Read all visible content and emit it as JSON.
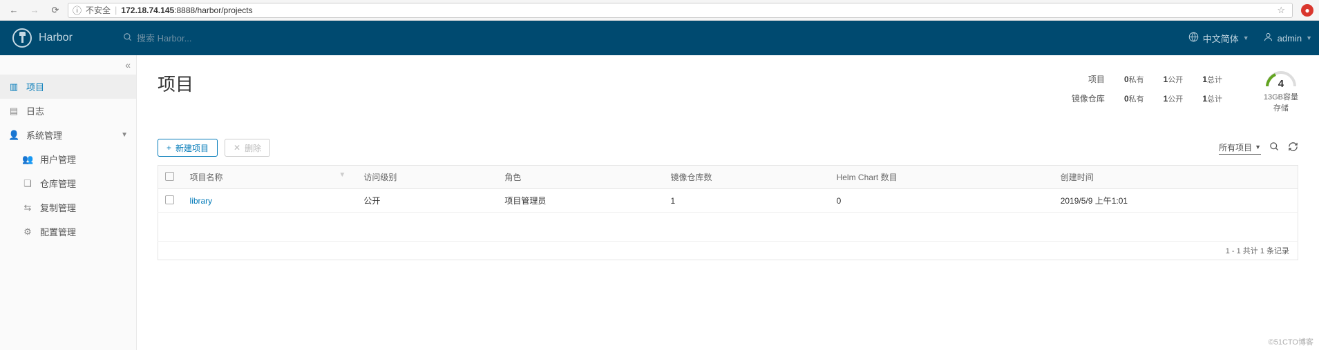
{
  "browser": {
    "insecure_label": "不安全",
    "url_host": "172.18.74.145",
    "url_rest": ":8888/harbor/projects"
  },
  "header": {
    "app_name": "Harbor",
    "search_placeholder": "搜索 Harbor...",
    "language_label": "中文简体",
    "user_label": "admin"
  },
  "sidebar": {
    "items": [
      {
        "icon": "projects",
        "label": "项目",
        "active": true
      },
      {
        "icon": "logs",
        "label": "日志"
      },
      {
        "icon": "admin",
        "label": "系统管理",
        "expandable": true
      }
    ],
    "admin_children": [
      {
        "icon": "users",
        "label": "用户管理"
      },
      {
        "icon": "repo",
        "label": "仓库管理"
      },
      {
        "icon": "replication",
        "label": "复制管理"
      },
      {
        "icon": "config",
        "label": "配置管理"
      }
    ]
  },
  "page": {
    "title": "项目",
    "stats": {
      "row1_label": "项目",
      "row2_label": "镜像仓库",
      "private": {
        "num": "0",
        "txt": "私有"
      },
      "public": {
        "num": "1",
        "txt": "公开"
      },
      "total": {
        "num": "1",
        "txt": "总计"
      },
      "r2_private": {
        "num": "0",
        "txt": "私有"
      },
      "r2_public": {
        "num": "1",
        "txt": "公开"
      },
      "r2_total": {
        "num": "1",
        "txt": "总计"
      }
    },
    "storage": {
      "value": "4",
      "capacity": "13GB容量",
      "label": "存储"
    }
  },
  "toolbar": {
    "new_label": "新建项目",
    "delete_label": "删除",
    "filter_label": "所有项目"
  },
  "table": {
    "headers": {
      "name": "项目名称",
      "access": "访问级别",
      "role": "角色",
      "repo_count": "镜像仓库数",
      "chart_count": "Helm Chart 数目",
      "created": "创建时间"
    },
    "rows": [
      {
        "name": "library",
        "access": "公开",
        "role": "项目管理员",
        "repo_count": "1",
        "chart_count": "0",
        "created": "2019/5/9 上午1:01"
      }
    ],
    "footer": "1 - 1 共计 1 条记录"
  },
  "watermark": "©51CTO博客"
}
